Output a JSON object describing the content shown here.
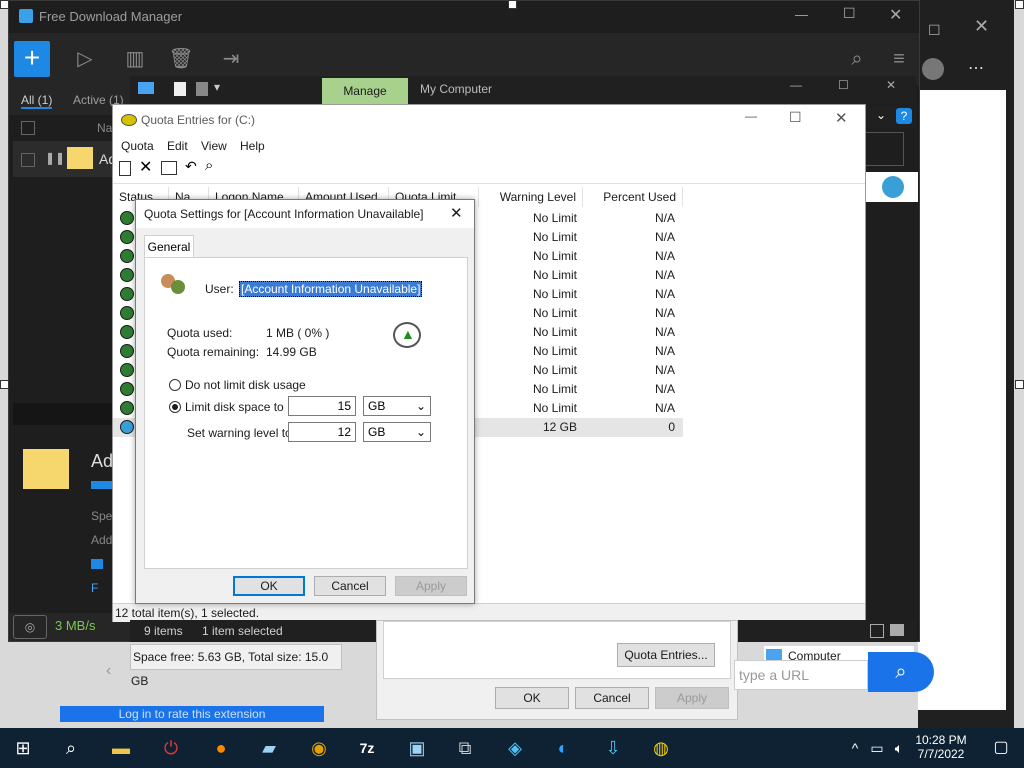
{
  "fdm": {
    "title": "Free Download Manager",
    "tabs": [
      "All (1)",
      "Active (1)"
    ],
    "list_header": "Na",
    "item_name": "Ad",
    "detail_name": "Ad",
    "detail_labels": [
      "Spe",
      "Add"
    ],
    "speed": "3 MB/s",
    "detail_link": "F"
  },
  "explorer": {
    "manage_tab": "Manage",
    "title": "My Computer",
    "status_items": "9 items",
    "status_selected": "1 item selected",
    "space": "Space free: 5.63 GB, Total size: 15.0 GB"
  },
  "quota_entries": {
    "title": "Quota Entries for  (C:)",
    "menu": [
      "Quota",
      "Edit",
      "View",
      "Help"
    ],
    "columns": [
      "Status",
      "Na...",
      "Logon Name",
      "Amount Used",
      "Quota Limit",
      "Warning Level",
      "Percent Used"
    ],
    "rows": [
      {
        "warning": "No Limit",
        "percent": "N/A"
      },
      {
        "warning": "No Limit",
        "percent": "N/A"
      },
      {
        "warning": "No Limit",
        "percent": "N/A"
      },
      {
        "warning": "No Limit",
        "percent": "N/A"
      },
      {
        "warning": "No Limit",
        "percent": "N/A"
      },
      {
        "warning": "No Limit",
        "percent": "N/A"
      },
      {
        "warning": "No Limit",
        "percent": "N/A"
      },
      {
        "warning": "No Limit",
        "percent": "N/A"
      },
      {
        "warning": "No Limit",
        "percent": "N/A"
      },
      {
        "warning": "No Limit",
        "percent": "N/A"
      },
      {
        "warning": "No Limit",
        "percent": "N/A"
      },
      {
        "warning": "12 GB",
        "percent": "0"
      }
    ],
    "status": "12 total item(s), 1 selected."
  },
  "quota_settings": {
    "title": "Quota Settings for [Account Information Unavailable]",
    "tab": "General",
    "user_label": "User:",
    "user_value": "[Account Information Unavailable]",
    "used_label": "Quota used:",
    "used_value": "1 MB ( 0% )",
    "remaining_label": "Quota remaining:",
    "remaining_value": "14.99 GB",
    "no_limit_label": "Do not limit disk usage",
    "limit_label": "Limit disk space to",
    "limit_value": "15",
    "limit_unit": "GB",
    "warning_label": "Set warning level to",
    "warning_value": "12",
    "warning_unit": "GB",
    "ok": "OK",
    "cancel": "Cancel",
    "apply": "Apply"
  },
  "properties": {
    "quota_entries_button": "Quota Entries...",
    "ok": "OK",
    "cancel": "Cancel",
    "apply": "Apply",
    "computer": "Computer"
  },
  "browser": {
    "url_placeholder": "type a URL",
    "rate_link": "Log in to rate this extension"
  },
  "taskbar": {
    "time": "10:28 PM",
    "date": "7/7/2022"
  }
}
